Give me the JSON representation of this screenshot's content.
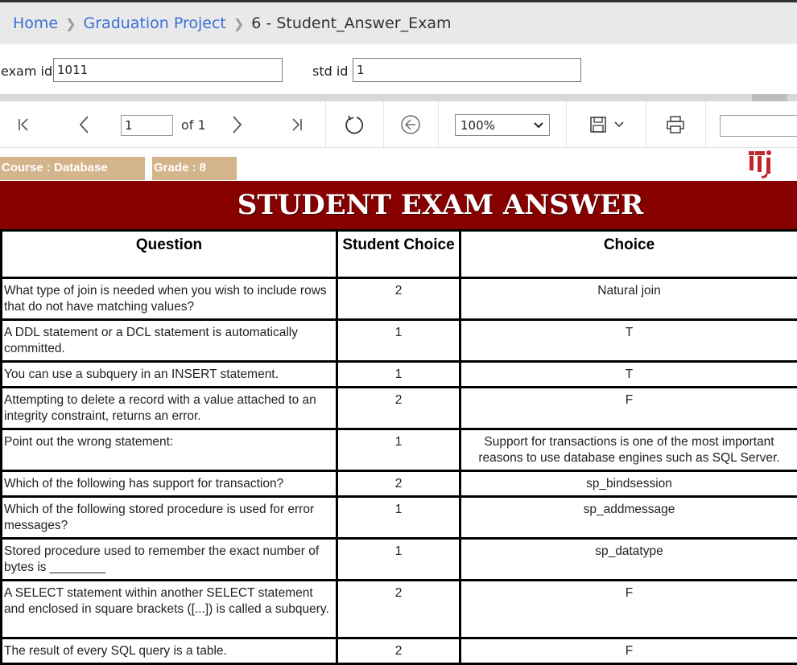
{
  "breadcrumb": {
    "items": [
      "Home",
      "Graduation Project"
    ],
    "current": "6 - Student_Answer_Exam"
  },
  "params": {
    "exam_id_label": "exam id",
    "exam_id_value": "1011",
    "std_id_label": "std id",
    "std_id_value": "1"
  },
  "toolbar": {
    "page_value": "1",
    "of_text": "of 1",
    "zoom": "100%"
  },
  "report": {
    "course_tag": "Course : Database",
    "grade_tag": "Grade : 8",
    "banner_title": "STUDENT EXAM ANSWER",
    "headers": {
      "question": "Question",
      "student_choice": "Student Choice",
      "choice": "Choice"
    },
    "rows": [
      {
        "question": "What type of join is needed when you wish to include rows that do not have matching values?",
        "student_choice": "2",
        "choice": "Natural join"
      },
      {
        "question": "A DDL statement or a DCL statement is automatically committed.",
        "student_choice": "1",
        "choice": "T"
      },
      {
        "question": "You can use a subquery in an INSERT statement.",
        "student_choice": "1",
        "choice": "T"
      },
      {
        "question": "Attempting to delete a record with a value attached to an integrity constraint, returns an error.",
        "student_choice": "2",
        "choice": "F"
      },
      {
        "question": "Point out the wrong statement:",
        "student_choice": "1",
        "choice": "Support for transactions is one of the most important reasons to use database engines such as SQL Server."
      },
      {
        "question": "Which of the following has support for transaction?",
        "student_choice": "2",
        "choice": "sp_bindsession"
      },
      {
        "question": "Which of the following stored procedure is used for error messages?",
        "student_choice": "1",
        "choice": "sp_addmessage"
      },
      {
        "question": "Stored procedure used to remember the exact number of bytes is ________",
        "student_choice": "1",
        "choice": "sp_datatype"
      },
      {
        "question": "A SELECT statement within another SELECT statement and enclosed in square brackets ([...]) is called a subquery.",
        "student_choice": "2",
        "choice": "F"
      },
      {
        "question": "The result of every SQL query is a table.",
        "student_choice": "2",
        "choice": "F"
      }
    ]
  },
  "colors": {
    "banner": "#870000",
    "tag": "#d4b48a",
    "link": "#3a6fd8",
    "logo": "#c0272d"
  }
}
